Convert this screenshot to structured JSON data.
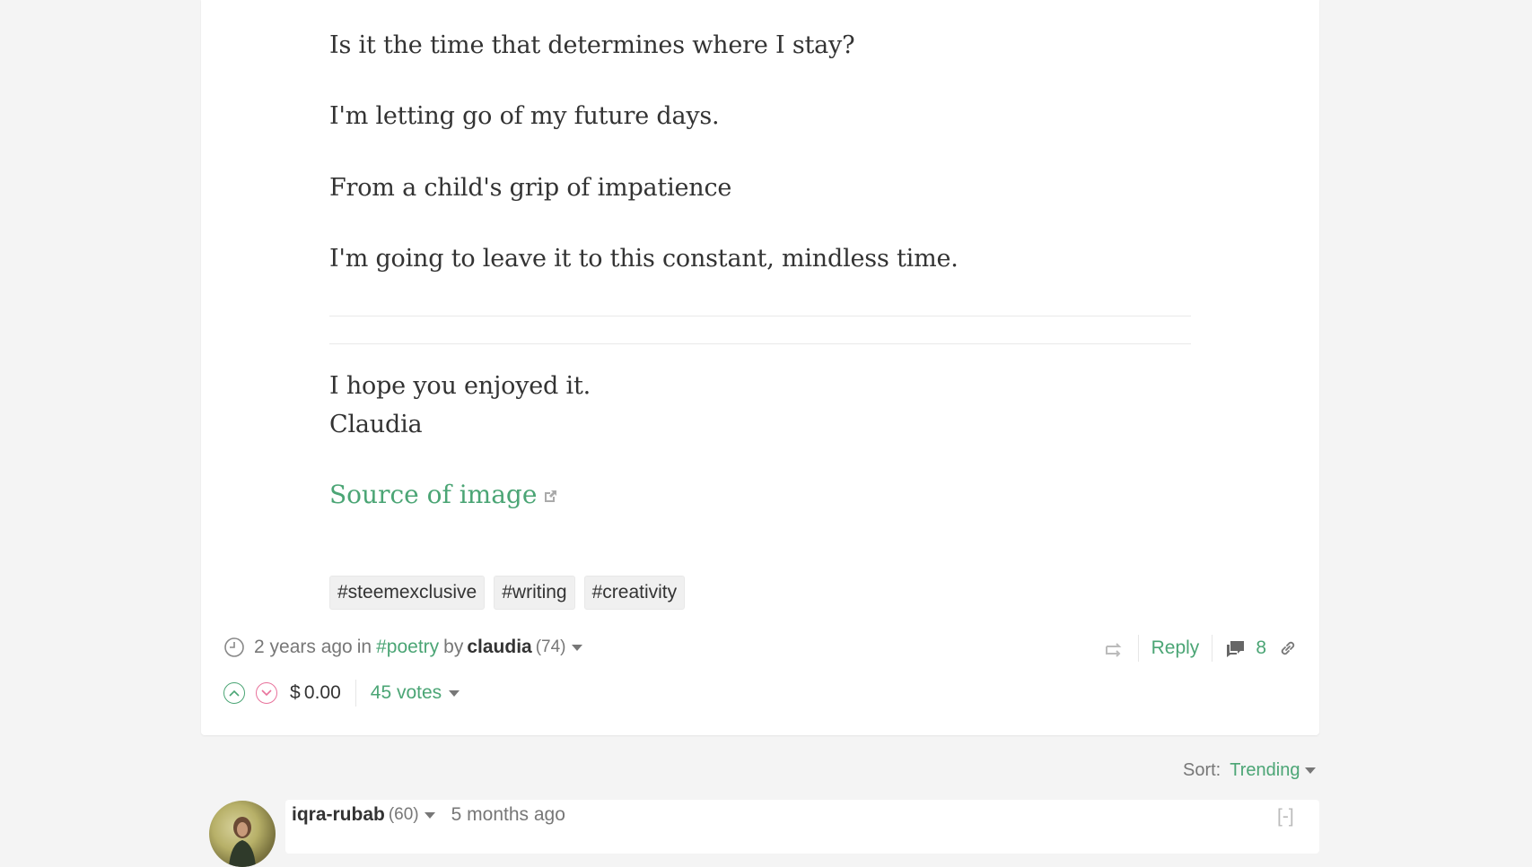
{
  "post": {
    "lines": [
      "Is it the time that determines where I stay?",
      "I'm letting go of my future days.",
      "From a child's grip of impatience",
      "I'm going to leave it to this constant, mindless time."
    ],
    "closing": [
      "I hope you enjoyed it.",
      "Claudia"
    ],
    "source_link": "Source of image",
    "tags": [
      "#steemexclusive",
      "#writing",
      "#creativity"
    ]
  },
  "meta": {
    "time": "2 years ago",
    "in_label": "in",
    "category": "#poetry",
    "by_label": "by",
    "author": "claudia",
    "reputation": "(74)"
  },
  "actions": {
    "reply": "Reply",
    "comment_count": "8"
  },
  "votes": {
    "payout": "$ 0.00",
    "count_label": "45 votes"
  },
  "sort": {
    "label": "Sort:",
    "value": "Trending"
  },
  "comment": {
    "author": "iqra-rubab",
    "reputation": "(60)",
    "time": "5 months ago",
    "collapse": "[-]"
  },
  "colors": {
    "accent": "#4ba575",
    "downvote": "#e8729b",
    "background": "#f4f4f4"
  }
}
